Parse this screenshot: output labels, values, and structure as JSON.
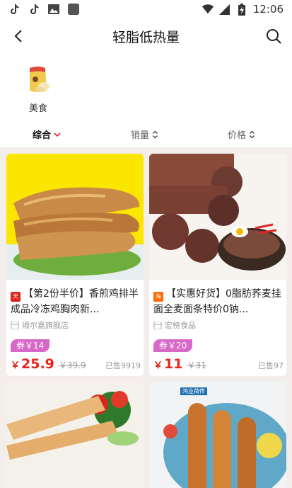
{
  "status_bar": {
    "time": "12:06",
    "left_icons": [
      "tiktok-icon",
      "tiktok-icon",
      "gallery-icon",
      "app-square-icon"
    ],
    "right_icons": [
      "wifi-icon",
      "signal-icon",
      "battery-charging-icon"
    ]
  },
  "header": {
    "title": "轻脂低热量",
    "back_icon": "back-arrow-icon",
    "search_icon": "search-icon"
  },
  "category": {
    "label": "美食"
  },
  "sort_tabs": [
    {
      "label": "综合",
      "active": true,
      "icon": "chevron-down-icon"
    },
    {
      "label": "销量",
      "active": false,
      "icon": "sort-arrows-icon"
    },
    {
      "label": "价格",
      "active": false,
      "icon": "sort-arrows-icon"
    }
  ],
  "products": [
    {
      "badge": "天猫",
      "title": "【第2份半价】香煎鸡排半成品冷冻鸡胸肉新...",
      "shop": "顺尔嘉旗舰店",
      "coupon": "券￥14",
      "price_symbol": "￥",
      "price": "25.9",
      "original_price": "￥39.9",
      "sold": "已售9919"
    },
    {
      "badge": "淘",
      "title": "【实惠好货】0脂肪荞麦挂面全麦面条特价0钠...",
      "shop": "宏榜食品",
      "coupon": "券￥20",
      "price_symbol": "￥",
      "price": "11",
      "original_price": "￥31",
      "sold": "已售97"
    },
    {
      "image": "salad-sausage-image"
    },
    {
      "image": "sausage-image",
      "image_label": "鸿业荷传"
    }
  ],
  "colors": {
    "accent_red": "#e8241c",
    "coupon_purple": "#d768c8",
    "grid_background": "#f3eeec"
  }
}
